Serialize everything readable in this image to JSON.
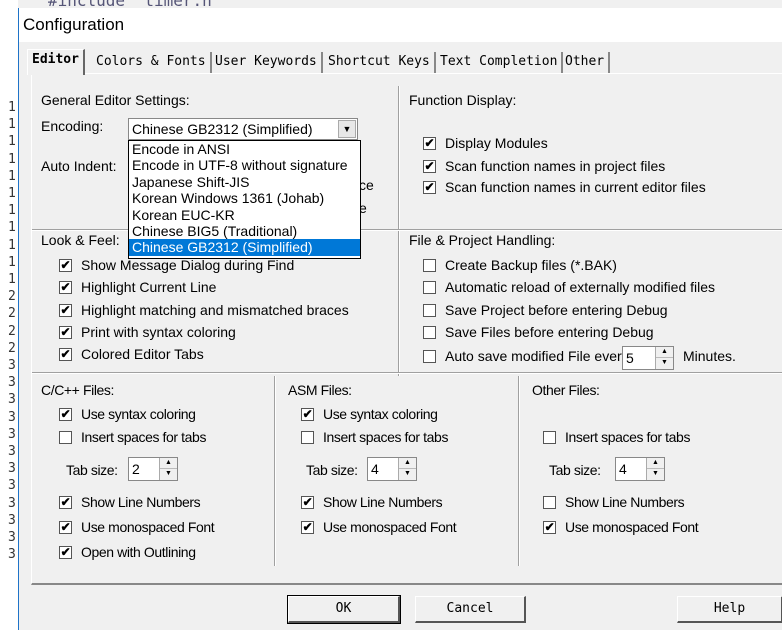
{
  "editor": {
    "code_line": "#include \"timer.h\"",
    "line_digits": [
      "4",
      "1",
      "1",
      "1",
      "1",
      "1",
      "1",
      "1",
      "1",
      "1",
      "1",
      "1",
      "2",
      "2",
      "2",
      "2",
      "3",
      "3",
      "3",
      "3",
      "3",
      "3",
      "3",
      "3",
      "3",
      "3",
      "3",
      "3"
    ]
  },
  "dialog": {
    "title": "Configuration"
  },
  "tabs": [
    {
      "label": "Editor",
      "active": true
    },
    {
      "label": "Colors & Fonts"
    },
    {
      "label": "User Keywords"
    },
    {
      "label": "Shortcut Keys"
    },
    {
      "label": "Text Completion"
    },
    {
      "label": "Other"
    }
  ],
  "general": {
    "title": "General Editor Settings:",
    "encoding_label": "Encoding:",
    "encoding_value": "Chinese GB2312 (Simplified)",
    "auto_indent_label": "Auto Indent:",
    "hidden_frag1": "ce",
    "hidden_frag2": "e",
    "encoding_options": [
      "Encode in ANSI",
      "Encode in UTF-8 without signature",
      "Japanese Shift-JIS",
      "Korean Windows 1361 (Johab)",
      "Korean EUC-KR",
      "Chinese BIG5 (Traditional)",
      "Chinese GB2312 (Simplified)"
    ],
    "selected_index": 6
  },
  "function_display": {
    "title": "Function Display:",
    "items": [
      {
        "label": "Display Modules",
        "checked": true
      },
      {
        "label": "Scan function names in project files",
        "checked": true
      },
      {
        "label": "Scan function names in current editor files",
        "checked": true
      }
    ]
  },
  "look_feel": {
    "title": "Look & Feel:",
    "items": [
      {
        "label": "Show Message Dialog during Find",
        "checked": true
      },
      {
        "label": "Highlight Current Line",
        "checked": true
      },
      {
        "label": "Highlight matching and mismatched braces",
        "checked": true
      },
      {
        "label": "Print with syntax coloring",
        "checked": true
      },
      {
        "label": "Colored Editor Tabs",
        "checked": true
      }
    ]
  },
  "file_project": {
    "title": "File & Project Handling:",
    "items": [
      {
        "label": "Create Backup files (*.BAK)",
        "checked": false
      },
      {
        "label": "Automatic reload of externally modified files",
        "checked": false
      },
      {
        "label": "Save Project before entering Debug",
        "checked": false
      },
      {
        "label": "Save Files before entering Debug",
        "checked": false
      },
      {
        "label": "Auto save modified File every",
        "checked": false
      }
    ],
    "autosave_value": "5",
    "minutes_label": "Minutes."
  },
  "cpp": {
    "title": "C/C++ Files:",
    "syntax": {
      "label": "Use syntax coloring",
      "checked": true
    },
    "spaces": {
      "label": "Insert spaces for tabs",
      "checked": false
    },
    "tab_size_label": "Tab size:",
    "tab_size": "2",
    "line_numbers": {
      "label": "Show Line Numbers",
      "checked": true
    },
    "mono": {
      "label": "Use monospaced Font",
      "checked": true
    },
    "outlining": {
      "label": "Open with Outlining",
      "checked": true
    }
  },
  "asm": {
    "title": "ASM Files:",
    "syntax": {
      "label": "Use syntax coloring",
      "checked": true
    },
    "spaces": {
      "label": "Insert spaces for tabs",
      "checked": false
    },
    "tab_size_label": "Tab size:",
    "tab_size": "4",
    "line_numbers": {
      "label": "Show Line Numbers",
      "checked": true
    },
    "mono": {
      "label": "Use monospaced Font",
      "checked": true
    }
  },
  "other": {
    "title": "Other Files:",
    "spaces": {
      "label": "Insert spaces for tabs",
      "checked": false
    },
    "tab_size_label": "Tab size:",
    "tab_size": "4",
    "line_numbers": {
      "label": "Show Line Numbers",
      "checked": false
    },
    "mono": {
      "label": "Use monospaced Font",
      "checked": true
    }
  },
  "buttons": {
    "ok": "OK",
    "cancel": "Cancel",
    "help": "Help"
  },
  "colors": {
    "selection": "#0078d7",
    "dialog_bg": "#f0f0f0"
  }
}
